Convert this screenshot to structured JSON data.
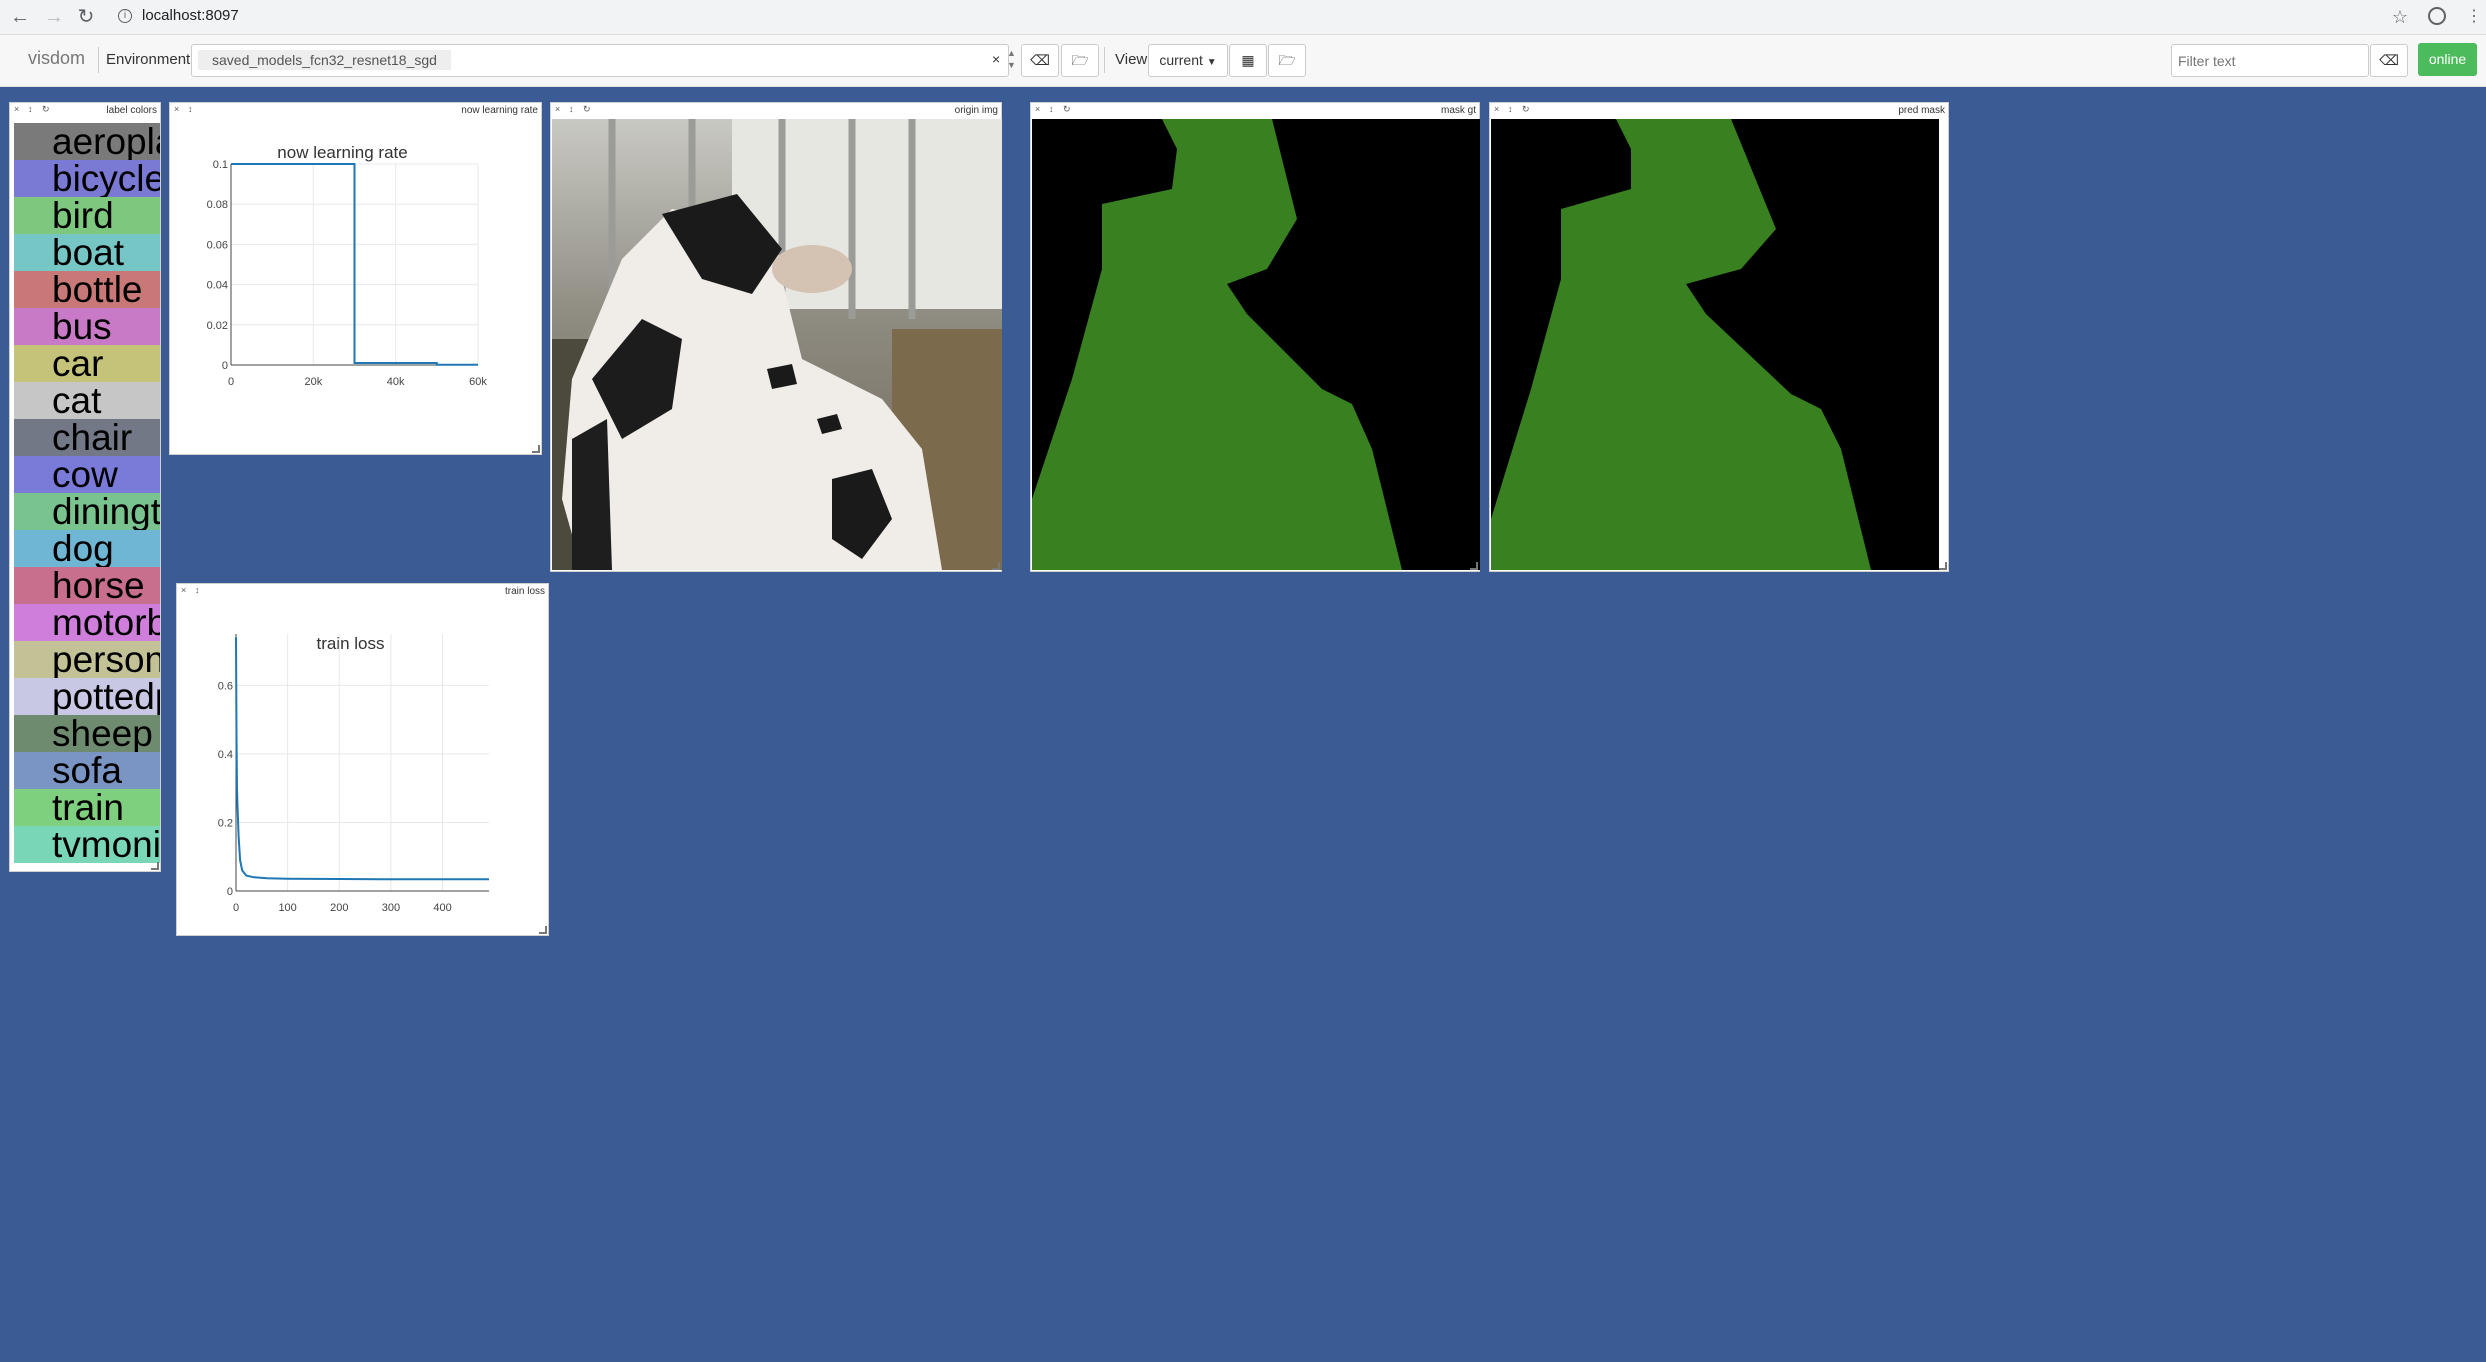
{
  "browser": {
    "url": "localhost:8097"
  },
  "toolbar": {
    "app_name": "visdom",
    "environment_label": "Environment",
    "environment_value": "saved_models_fcn32_resnet18_sgd",
    "view_label": "View",
    "view_value": "current",
    "filter_placeholder": "Filter text",
    "status": "online"
  },
  "panes": {
    "label_colors": {
      "title": "label colors",
      "labels": [
        {
          "text": "aeroplane",
          "color": "#7a7a7a"
        },
        {
          "text": "bicycle",
          "color": "#7a7ad4"
        },
        {
          "text": "bird",
          "color": "#7ec77e"
        },
        {
          "text": "boat",
          "color": "#77c6c6"
        },
        {
          "text": "bottle",
          "color": "#c97878"
        },
        {
          "text": "bus",
          "color": "#c87ac6"
        },
        {
          "text": "car",
          "color": "#c5c27a"
        },
        {
          "text": "cat",
          "color": "#c6c6c6"
        },
        {
          "text": "chair",
          "color": "#737886"
        },
        {
          "text": "cow",
          "color": "#7a7ad8"
        },
        {
          "text": "diningtable",
          "color": "#79c38f"
        },
        {
          "text": "dog",
          "color": "#6fb6d4"
        },
        {
          "text": "horse",
          "color": "#c96f8e"
        },
        {
          "text": "motorbike",
          "color": "#cf7fdb"
        },
        {
          "text": "person",
          "color": "#c2c296"
        },
        {
          "text": "pottedplant",
          "color": "#c8c8e4"
        },
        {
          "text": "sheep",
          "color": "#6f8b6f"
        },
        {
          "text": "sofa",
          "color": "#7a95c3"
        },
        {
          "text": "train",
          "color": "#7ed07e"
        },
        {
          "text": "tvmonitor",
          "color": "#79d6b6"
        }
      ]
    },
    "lr": {
      "title": "now learning rate"
    },
    "origin": {
      "title": "origin img"
    },
    "mask_gt": {
      "title": "mask gt"
    },
    "pred_mask": {
      "title": "pred mask"
    },
    "loss": {
      "title": "train loss"
    }
  },
  "chart_data": [
    {
      "type": "line",
      "title": "now learning rate",
      "xlabel": "",
      "ylabel": "",
      "xlim": [
        0,
        60000
      ],
      "ylim": [
        0,
        0.1
      ],
      "x_ticks": [
        "0",
        "20k",
        "40k",
        "60k"
      ],
      "y_ticks": [
        "0",
        "0.02",
        "0.04",
        "0.06",
        "0.08",
        "0.1"
      ],
      "grid": true,
      "series": [
        {
          "color": "#1f77b4",
          "x": [
            0,
            30000,
            30000,
            50000,
            50000,
            60000
          ],
          "y": [
            0.1,
            0.1,
            0.001,
            0.001,
            0.0001,
            0.0001
          ]
        }
      ]
    },
    {
      "type": "line",
      "title": "train loss",
      "xlabel": "",
      "ylabel": "",
      "xlim": [
        0,
        490
      ],
      "ylim": [
        0,
        0.75
      ],
      "x_ticks": [
        "0",
        "100",
        "200",
        "300",
        "400"
      ],
      "y_ticks": [
        "0",
        "0.2",
        "0.4",
        "0.6"
      ],
      "grid": true,
      "series": [
        {
          "color": "#1f77b4",
          "x": [
            0,
            1,
            2,
            3,
            5,
            8,
            12,
            20,
            35,
            60,
            100,
            200,
            300,
            400,
            490
          ],
          "y": [
            0.74,
            0.45,
            0.3,
            0.25,
            0.16,
            0.09,
            0.06,
            0.045,
            0.04,
            0.037,
            0.036,
            0.035,
            0.034,
            0.034,
            0.034
          ]
        }
      ]
    }
  ]
}
